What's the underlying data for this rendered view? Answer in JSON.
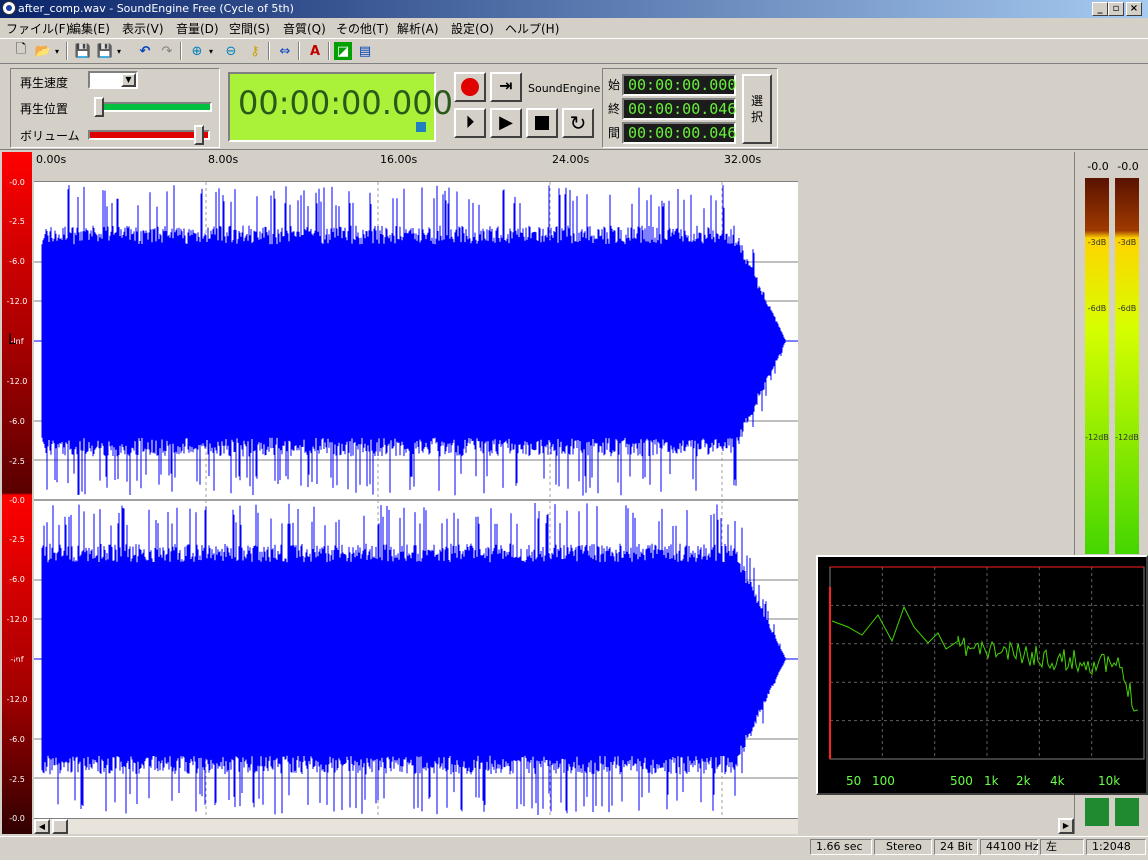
{
  "window": {
    "title": "after_comp.wav - SoundEngine Free (Cycle of 5th)"
  },
  "menu": [
    "ファイル(F)",
    "編集(E)",
    "表示(V)",
    "音量(D)",
    "空間(S)",
    "音質(Q)",
    "その他(T)",
    "解析(A)",
    "設定(O)",
    "ヘルプ(H)"
  ],
  "controls": {
    "speed_label": "再生速度",
    "position_label": "再生位置",
    "volume_label": "ボリューム",
    "position": 0,
    "volume": 0.95
  },
  "time_display": "00:00:00.000",
  "brand": "SoundEngine",
  "range": {
    "start_label": "始",
    "start_value": "00:00:00.000",
    "end_label": "終",
    "end_value": "00:00:00.046",
    "length_label": "間",
    "length_value": "00:00:00.046",
    "select_button": "選\n択"
  },
  "ruler": [
    "0.00s",
    "8.00s",
    "16.00s",
    "24.00s",
    "32.00s"
  ],
  "scale_labels": [
    "-0.0",
    "-2.5",
    "-6.0",
    "-12.0",
    "-Inf",
    "-12.0",
    "-6.0",
    "-2.5",
    "-0.0"
  ],
  "channels": {
    "left": "L",
    "right": "R"
  },
  "meter": {
    "peak_left": "-0.0",
    "peak_right": "-0.0",
    "ticks": [
      "-3dB",
      "-6dB",
      "-12dB"
    ],
    "colors": {
      "top": "#5a1200",
      "mid": "#ffd400",
      "low": "#44d600"
    }
  },
  "spectrum": {
    "x_labels": [
      "50",
      "100",
      "500",
      "1k",
      "2k",
      "4k",
      "10k"
    ],
    "line_color": "#44d600"
  },
  "status": {
    "duration": "1.66 sec",
    "channels": "Stereo",
    "bits": "24 Bit",
    "rate": "44100 Hz",
    "side": "左",
    "zoom": "1:2048"
  },
  "colors": {
    "wave": "#0000ff",
    "lcd": "#aaf23a",
    "title_bar": "#0a246a"
  }
}
